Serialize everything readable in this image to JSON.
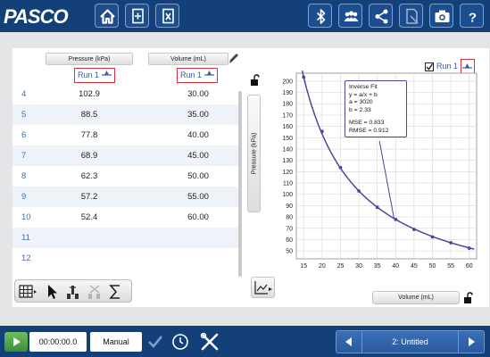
{
  "app": {
    "logo": "PASCO"
  },
  "toolbar": {
    "icons": [
      "home-icon",
      "new-file-icon",
      "export-icon",
      "bluetooth-icon",
      "sharing-icon",
      "share-icon",
      "journal-icon",
      "camera-icon",
      "help-icon"
    ]
  },
  "table": {
    "columns": [
      {
        "header": "Pressure (kPa)",
        "run": "Run 1"
      },
      {
        "header": "Volume (mL)",
        "run": "Run 1"
      }
    ],
    "rows": [
      {
        "index": "4",
        "pressure": "102.9",
        "volume": "30.00"
      },
      {
        "index": "5",
        "pressure": "88.5",
        "volume": "35.00"
      },
      {
        "index": "6",
        "pressure": "77.8",
        "volume": "40.00"
      },
      {
        "index": "7",
        "pressure": "68.9",
        "volume": "45.00"
      },
      {
        "index": "8",
        "pressure": "62.3",
        "volume": "50.00"
      },
      {
        "index": "9",
        "pressure": "57.2",
        "volume": "55.00"
      },
      {
        "index": "10",
        "pressure": "52.4",
        "volume": "60.00"
      },
      {
        "index": "11",
        "pressure": "",
        "volume": ""
      },
      {
        "index": "12",
        "pressure": "",
        "volume": ""
      }
    ]
  },
  "graph": {
    "legend": "Run 1",
    "y_label": "Pressure (kPa)",
    "x_label": "Volume (mL)",
    "fit": {
      "title": "Inverse Fit",
      "equation": "y = a/x + b",
      "a": "a = 3020",
      "b": "b = 2.33",
      "mse": "MSE = 0.833",
      "rmse": "RMSE = 0.912"
    }
  },
  "chart_data": {
    "type": "scatter",
    "x": [
      15,
      20,
      25,
      30,
      35,
      40,
      45,
      50,
      55,
      60
    ],
    "y": [
      203.5,
      155.6,
      123.6,
      102.9,
      88.5,
      77.8,
      68.9,
      62.3,
      57.2,
      52.4
    ],
    "xlabel": "Volume (mL)",
    "ylabel": "Pressure (kPa)",
    "xlim": [
      13,
      62
    ],
    "ylim": [
      43,
      207
    ],
    "xticks": [
      "15",
      "20",
      "25",
      "30",
      "35",
      "40",
      "45",
      "50",
      "55",
      "60"
    ],
    "yticks": [
      "50",
      "60",
      "70",
      "80",
      "90",
      "100",
      "110",
      "120",
      "130",
      "140",
      "150",
      "160",
      "170",
      "180",
      "190",
      "200"
    ],
    "grid": true,
    "series": [
      {
        "name": "Run 1",
        "color": "#5b3f9a"
      }
    ],
    "fit": {
      "type": "inverse",
      "a": 3020,
      "b": 2.33
    }
  },
  "controls": {
    "time": "00:00:00.0",
    "mode": "Manual",
    "page": "2: Untitled"
  }
}
